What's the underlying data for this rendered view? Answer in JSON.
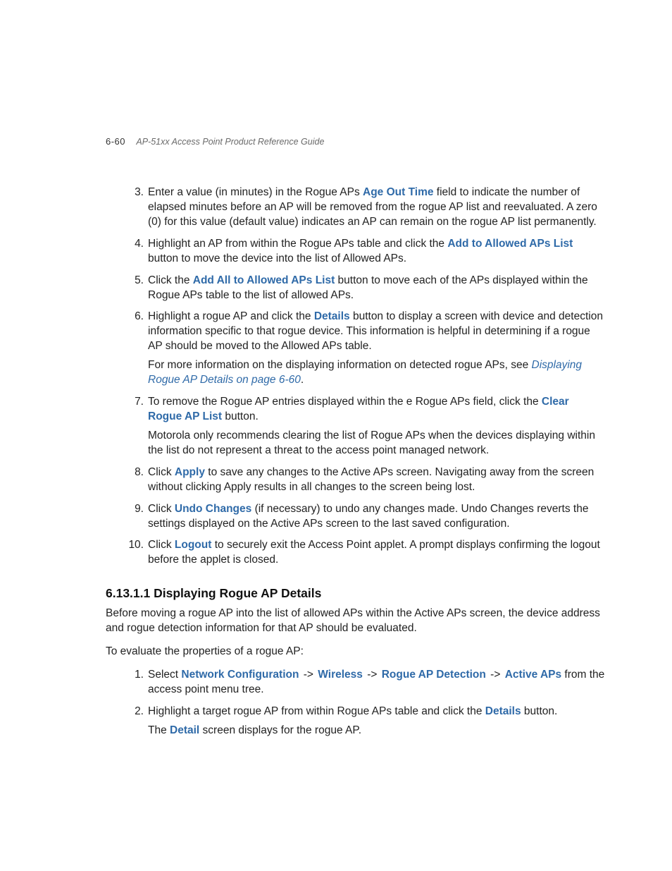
{
  "header": {
    "pageNumber": "6-60",
    "guideTitle": "AP-51xx Access Point Product Reference Guide"
  },
  "stepsA": [
    {
      "num": "3.",
      "parts": [
        {
          "t": "Enter a value (in minutes) in the Rogue APs "
        },
        {
          "t": "Age Out Time",
          "cls": "bold-blue"
        },
        {
          "t": " field to indicate the number of elapsed minutes before an AP will be removed from the rogue AP list and reevaluated. A zero (0) for this value (default value) indicates an AP can remain on the rogue AP list permanently."
        }
      ]
    },
    {
      "num": "4.",
      "parts": [
        {
          "t": "Highlight an AP from within the Rogue APs table and click the "
        },
        {
          "t": "Add to Allowed APs List",
          "cls": "bold-blue"
        },
        {
          "t": " button to move the device into the list of Allowed APs."
        }
      ]
    },
    {
      "num": "5.",
      "parts": [
        {
          "t": "Click the "
        },
        {
          "t": "Add All to Allowed APs List",
          "cls": "bold-blue"
        },
        {
          "t": " button to move each of the APs displayed within the Rogue APs table to the list of allowed APs."
        }
      ]
    },
    {
      "num": "6.",
      "parts": [
        {
          "t": "Highlight a rogue AP and click the "
        },
        {
          "t": "Details",
          "cls": "bold-blue"
        },
        {
          "t": " button to display a screen with device and detection information specific to that rogue device. This information is helpful in determining if a rogue AP should be moved to the Allowed APs table."
        }
      ],
      "extra": [
        {
          "t": "For more information on the displaying information on detected rogue APs, see "
        },
        {
          "t": "Displaying Rogue AP Details on page 6-60",
          "cls": "italic-link"
        },
        {
          "t": "."
        }
      ]
    },
    {
      "num": "7.",
      "parts": [
        {
          "t": "To remove the Rogue AP entries displayed within the e Rogue APs field, click the "
        },
        {
          "t": "Clear Rogue AP List",
          "cls": "bold-blue"
        },
        {
          "t": " button."
        }
      ],
      "extra": [
        {
          "t": "Motorola only recommends clearing the list of Rogue APs when the devices displaying within the list do not represent a threat to the access point managed network."
        }
      ]
    },
    {
      "num": "8.",
      "parts": [
        {
          "t": "Click "
        },
        {
          "t": "Apply",
          "cls": "bold-blue"
        },
        {
          "t": " to save any changes to the Active APs screen. Navigating away from the screen without clicking Apply results in all changes to the screen being lost."
        }
      ]
    },
    {
      "num": "9.",
      "parts": [
        {
          "t": "Click "
        },
        {
          "t": "Undo Changes",
          "cls": "bold-blue"
        },
        {
          "t": " (if necessary) to undo any changes made. Undo Changes reverts the settings displayed on the Active APs screen to the last saved configuration."
        }
      ]
    },
    {
      "num": "10.",
      "parts": [
        {
          "t": "Click "
        },
        {
          "t": "Logout",
          "cls": "bold-blue"
        },
        {
          "t": " to securely exit the Access Point applet. A prompt displays confirming the logout before the applet is closed."
        }
      ]
    }
  ],
  "section": {
    "heading": "6.13.1.1  Displaying Rogue AP Details",
    "intro": "Before moving a rogue AP into the list of allowed APs within the Active APs screen, the device address and rogue detection information for that AP should be evaluated.",
    "lead": "To evaluate the properties of a rogue AP:"
  },
  "stepsB": [
    {
      "num": "1.",
      "parts": [
        {
          "t": "Select "
        },
        {
          "t": "Network Configuration",
          "cls": "bold-blue"
        },
        {
          "t": " -> ",
          "cls": "arrow"
        },
        {
          "t": "Wireless",
          "cls": "bold-blue"
        },
        {
          "t": " -> ",
          "cls": "arrow"
        },
        {
          "t": "Rogue AP Detection",
          "cls": "bold-blue"
        },
        {
          "t": " -> ",
          "cls": "arrow"
        },
        {
          "t": "Active APs",
          "cls": "bold-blue"
        },
        {
          "t": " from the access point menu tree."
        }
      ]
    },
    {
      "num": "2.",
      "parts": [
        {
          "t": "Highlight a target rogue AP from within Rogue APs table and click the "
        },
        {
          "t": "Details",
          "cls": "bold-blue"
        },
        {
          "t": " button."
        }
      ],
      "extra": [
        {
          "t": "The "
        },
        {
          "t": "Detail",
          "cls": "bold-blue"
        },
        {
          "t": " screen displays for the rogue AP."
        }
      ]
    }
  ]
}
